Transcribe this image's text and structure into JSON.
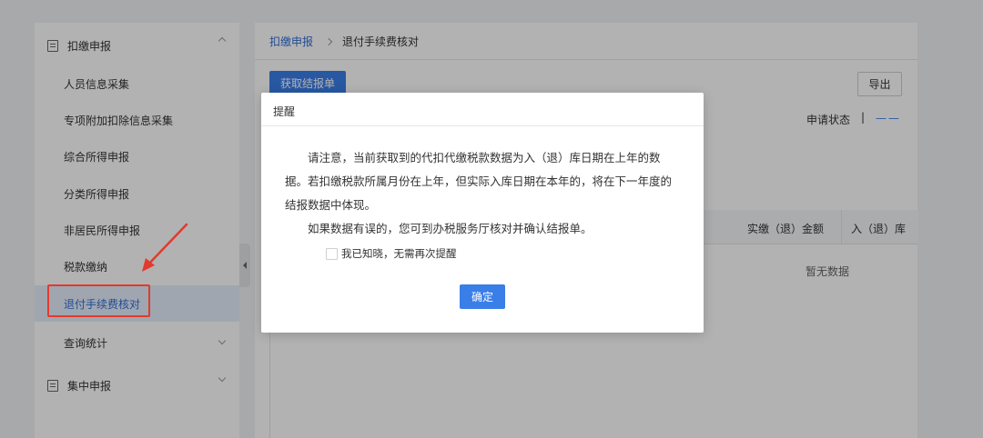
{
  "sidebar": {
    "group1_label": "扣缴申报",
    "items": [
      {
        "label": "人员信息采集"
      },
      {
        "label": "专项附加扣除信息采集"
      },
      {
        "label": "综合所得申报"
      },
      {
        "label": "分类所得申报"
      },
      {
        "label": "非居民所得申报"
      },
      {
        "label": "税款缴纳"
      },
      {
        "label": "退付手续费核对"
      },
      {
        "label": "查询统计"
      }
    ],
    "active_item": "退付手续费核对",
    "group2_label": "集中申报"
  },
  "breadcrumb": {
    "parent": "扣缴申报",
    "current": "退付手续费核对"
  },
  "toolbar": {
    "get_statement_label": "获取结报单",
    "export_label": "导出"
  },
  "status": {
    "label": "申请状态",
    "separator": "|",
    "value": "— —"
  },
  "table": {
    "headers": [
      "实缴（退）金额",
      "入（退）库"
    ],
    "empty_text": "暂无数据"
  },
  "dialog": {
    "title": "提醒",
    "paragraph1": "请注意，当前获取到的代扣代缴税款数据为入（退）库日期在上年的数据。若扣缴税款所属月份在上年，但实际入库日期在本年的，将在下一年度的结报数据中体现。",
    "paragraph2": "如果数据有误的，您可到办税服务厅核对并确认结报单。",
    "checkbox_label": "我已知晓，无需再次提醒",
    "checkbox_checked": false,
    "confirm_label": "确定"
  },
  "colors": {
    "primary": "#3a7ee8",
    "annotation_red": "#e23a2e",
    "active_bg": "#e6eefb"
  }
}
